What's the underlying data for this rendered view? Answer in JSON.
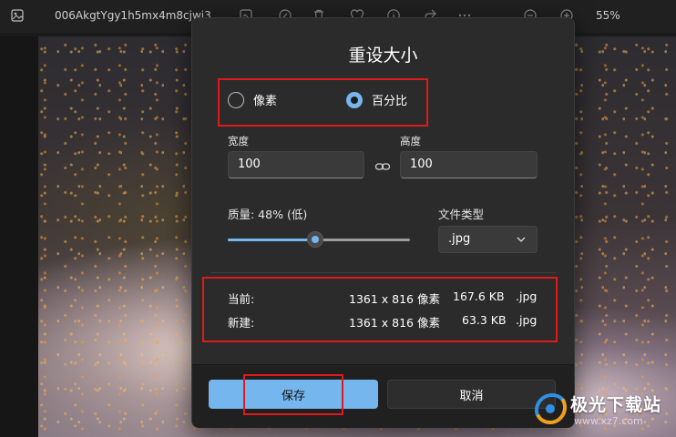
{
  "titlebar": {
    "file_name": "006AkgtYgy1h5mx4m8cjwj3",
    "zoom": "55%",
    "icons": [
      "image-icon",
      "enhance-icon",
      "crop-icon",
      "delete-icon",
      "heart-icon",
      "info-icon",
      "share-icon",
      "more-icon",
      "zoom-out-icon",
      "zoom-in-icon"
    ]
  },
  "dialog": {
    "title": "重设大小",
    "mode_options": [
      {
        "label": "像素",
        "selected": false
      },
      {
        "label": "百分比",
        "selected": true
      }
    ],
    "width_label": "宽度",
    "width_value": "100",
    "height_label": "高度",
    "height_value": "100",
    "quality_label": "质量: 48% (低)",
    "quality_value": 0.48,
    "filetype_label": "文件类型",
    "filetype_value": ".jpg",
    "current": {
      "label": "当前:",
      "dims": "1361 x 816 像素",
      "size": "167.6 KB",
      "ext": ".jpg"
    },
    "new": {
      "label": "新建:",
      "dims": "1361 x 816 像素",
      "size": "63.3 KB",
      "ext": ".jpg"
    },
    "save_label": "保存",
    "cancel_label": "取消"
  },
  "watermark": {
    "title": "极光下载站",
    "url": "www.xz7.com"
  },
  "colors": {
    "accent": "#75b6ee",
    "highlight_box": "#e01a1a",
    "dialog_bg": "#2b2b2b"
  }
}
